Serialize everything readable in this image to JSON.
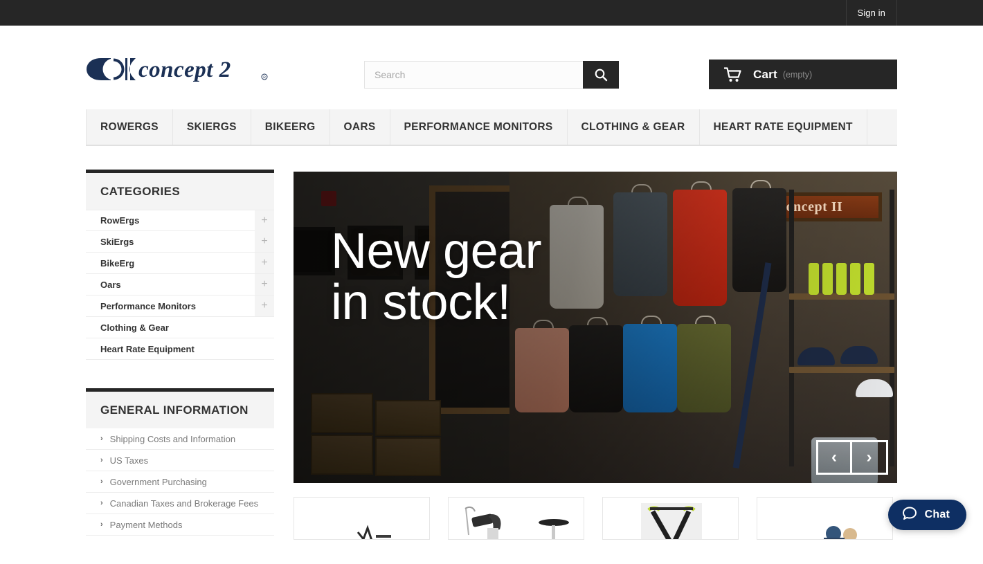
{
  "topbar": {
    "signin_label": "Sign in"
  },
  "header": {
    "logo_text": "concept 2",
    "search": {
      "placeholder": "Search",
      "value": "",
      "icon": "search-icon"
    },
    "cart": {
      "icon": "shopping-cart-icon",
      "label": "Cart",
      "status": "(empty)"
    }
  },
  "mainnav": {
    "items": [
      {
        "label": "ROWERGS"
      },
      {
        "label": "SKIERGS"
      },
      {
        "label": "BIKEERG"
      },
      {
        "label": "OARS"
      },
      {
        "label": "PERFORMANCE MONITORS"
      },
      {
        "label": "CLOTHING & GEAR"
      },
      {
        "label": "HEART RATE EQUIPMENT"
      }
    ]
  },
  "sidebar": {
    "categories": {
      "title": "CATEGORIES",
      "items": [
        {
          "label": "RowErgs",
          "expander": "+"
        },
        {
          "label": "SkiErgs",
          "expander": "+"
        },
        {
          "label": "BikeErg",
          "expander": "+"
        },
        {
          "label": "Oars",
          "expander": "+"
        },
        {
          "label": "Performance Monitors",
          "expander": "+"
        },
        {
          "label": "Clothing & Gear",
          "expander": ""
        },
        {
          "label": "Heart Rate Equipment",
          "expander": ""
        }
      ]
    },
    "general_information": {
      "title": "GENERAL INFORMATION",
      "items": [
        {
          "label": "Shipping Costs and Information",
          "icon": "chevron-right-icon"
        },
        {
          "label": "US Taxes",
          "icon": "chevron-right-icon"
        },
        {
          "label": "Government Purchasing",
          "icon": "chevron-right-icon"
        },
        {
          "label": "Canadian Taxes and Brokerage Fees",
          "icon": "chevron-right-icon"
        },
        {
          "label": "Payment Methods",
          "icon": "chevron-right-icon"
        }
      ]
    }
  },
  "hero": {
    "headline": "New gear\nin stock!",
    "sign_text": "Concept II",
    "prev_label": "‹",
    "next_label": "›"
  },
  "product_cards": [
    {
      "name": "product-card-1"
    },
    {
      "name": "product-card-2"
    },
    {
      "name": "product-card-3"
    },
    {
      "name": "product-card-4"
    }
  ],
  "chat": {
    "label": "Chat",
    "icon": "chat-bubble-icon",
    "color": "#0e2f63"
  },
  "colors": {
    "topbar": "#262626",
    "nav_bg": "#f4f4f4",
    "logo_navy": "#1b3055",
    "accent_dark": "#262626"
  }
}
